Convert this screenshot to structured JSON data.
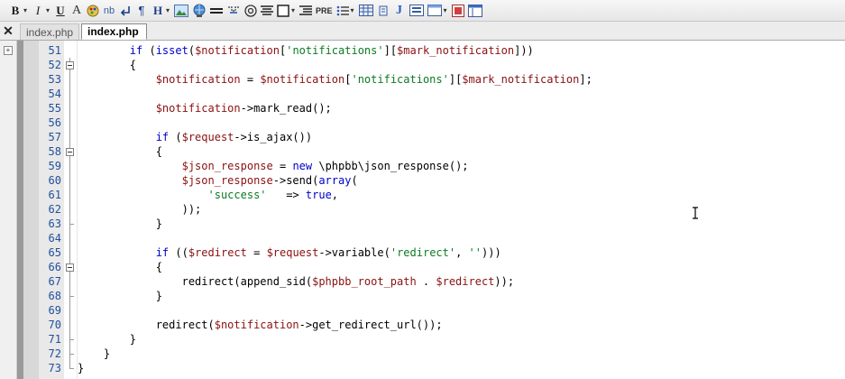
{
  "toolbar": {
    "bold_label": "B",
    "italic_label": "I",
    "underline_label": "U",
    "font_label": "A",
    "nbsp_label": "nb",
    "heading_label": "H",
    "pre_label": "PRE",
    "java_label": "J",
    "icons": [
      "bold",
      "italic",
      "underline",
      "font-icon",
      "palette-icon",
      "nbsp",
      "line-break-icon",
      "paragraph-icon",
      "heading",
      "image-icon",
      "globe-link-icon",
      "horizontal-rule-icon",
      "anchor-icon",
      "target-icon",
      "align-icon",
      "box-icon",
      "list-icon",
      "pre",
      "ordered-list-icon",
      "table-icon",
      "script-icon",
      "form-icon",
      "frame-icon",
      "color-icon",
      "window-icon"
    ]
  },
  "tabs": [
    {
      "label": "index.php",
      "active": false
    },
    {
      "label": "index.php",
      "active": true
    }
  ],
  "editor": {
    "close_label": "✕",
    "lines": [
      {
        "num": "51",
        "fold": "none",
        "html": "        <span class=\"k\">if</span> (<span class=\"k\">isset</span>(<span class=\"v\">$notification</span>[<span class=\"s\">'notifications'</span>][<span class=\"v\">$mark_notification</span>]))"
      },
      {
        "num": "52",
        "fold": "open",
        "html": "        {"
      },
      {
        "num": "53",
        "fold": "line",
        "html": "            <span class=\"v\">$notification</span> = <span class=\"v\">$notification</span>[<span class=\"s\">'notifications'</span>][<span class=\"v\">$mark_notification</span>];"
      },
      {
        "num": "54",
        "fold": "line",
        "html": ""
      },
      {
        "num": "55",
        "fold": "line",
        "html": "            <span class=\"v\">$notification</span>-&gt;mark_read();"
      },
      {
        "num": "56",
        "fold": "line",
        "html": ""
      },
      {
        "num": "57",
        "fold": "line",
        "html": "            <span class=\"k\">if</span> (<span class=\"v\">$request</span>-&gt;is_ajax())"
      },
      {
        "num": "58",
        "fold": "open",
        "html": "            {"
      },
      {
        "num": "59",
        "fold": "line",
        "html": "                <span class=\"v\">$json_response</span> = <span class=\"k\">new</span> \\phpbb\\json_response();"
      },
      {
        "num": "60",
        "fold": "line",
        "html": "                <span class=\"v\">$json_response</span>-&gt;send(<span class=\"k\">array</span>("
      },
      {
        "num": "61",
        "fold": "line",
        "html": "                    <span class=\"s\">'success'</span>   =&gt; <span class=\"k\">true</span>,"
      },
      {
        "num": "62",
        "fold": "line",
        "html": "                ));"
      },
      {
        "num": "63",
        "fold": "end",
        "html": "            }"
      },
      {
        "num": "64",
        "fold": "line",
        "html": ""
      },
      {
        "num": "65",
        "fold": "line",
        "html": "            <span class=\"k\">if</span> ((<span class=\"v\">$redirect</span> = <span class=\"v\">$request</span>-&gt;variable(<span class=\"s\">'redirect'</span>, <span class=\"s\">''</span>)))"
      },
      {
        "num": "66",
        "fold": "open",
        "html": "            {"
      },
      {
        "num": "67",
        "fold": "line",
        "html": "                redirect(append_sid(<span class=\"v\">$phpbb_root_path</span> . <span class=\"v\">$redirect</span>));"
      },
      {
        "num": "68",
        "fold": "end",
        "html": "            }"
      },
      {
        "num": "69",
        "fold": "line",
        "html": ""
      },
      {
        "num": "70",
        "fold": "line",
        "html": "            redirect(<span class=\"v\">$notification</span>-&gt;get_redirect_url());"
      },
      {
        "num": "71",
        "fold": "end",
        "html": "        }"
      },
      {
        "num": "72",
        "fold": "end",
        "html": "    }"
      },
      {
        "num": "73",
        "fold": "end",
        "html": "}"
      }
    ]
  },
  "colors": {
    "keyword": "#0000cc",
    "variable": "#8a1010",
    "string": "#0c7a22",
    "line_number": "#1f4f9e"
  }
}
